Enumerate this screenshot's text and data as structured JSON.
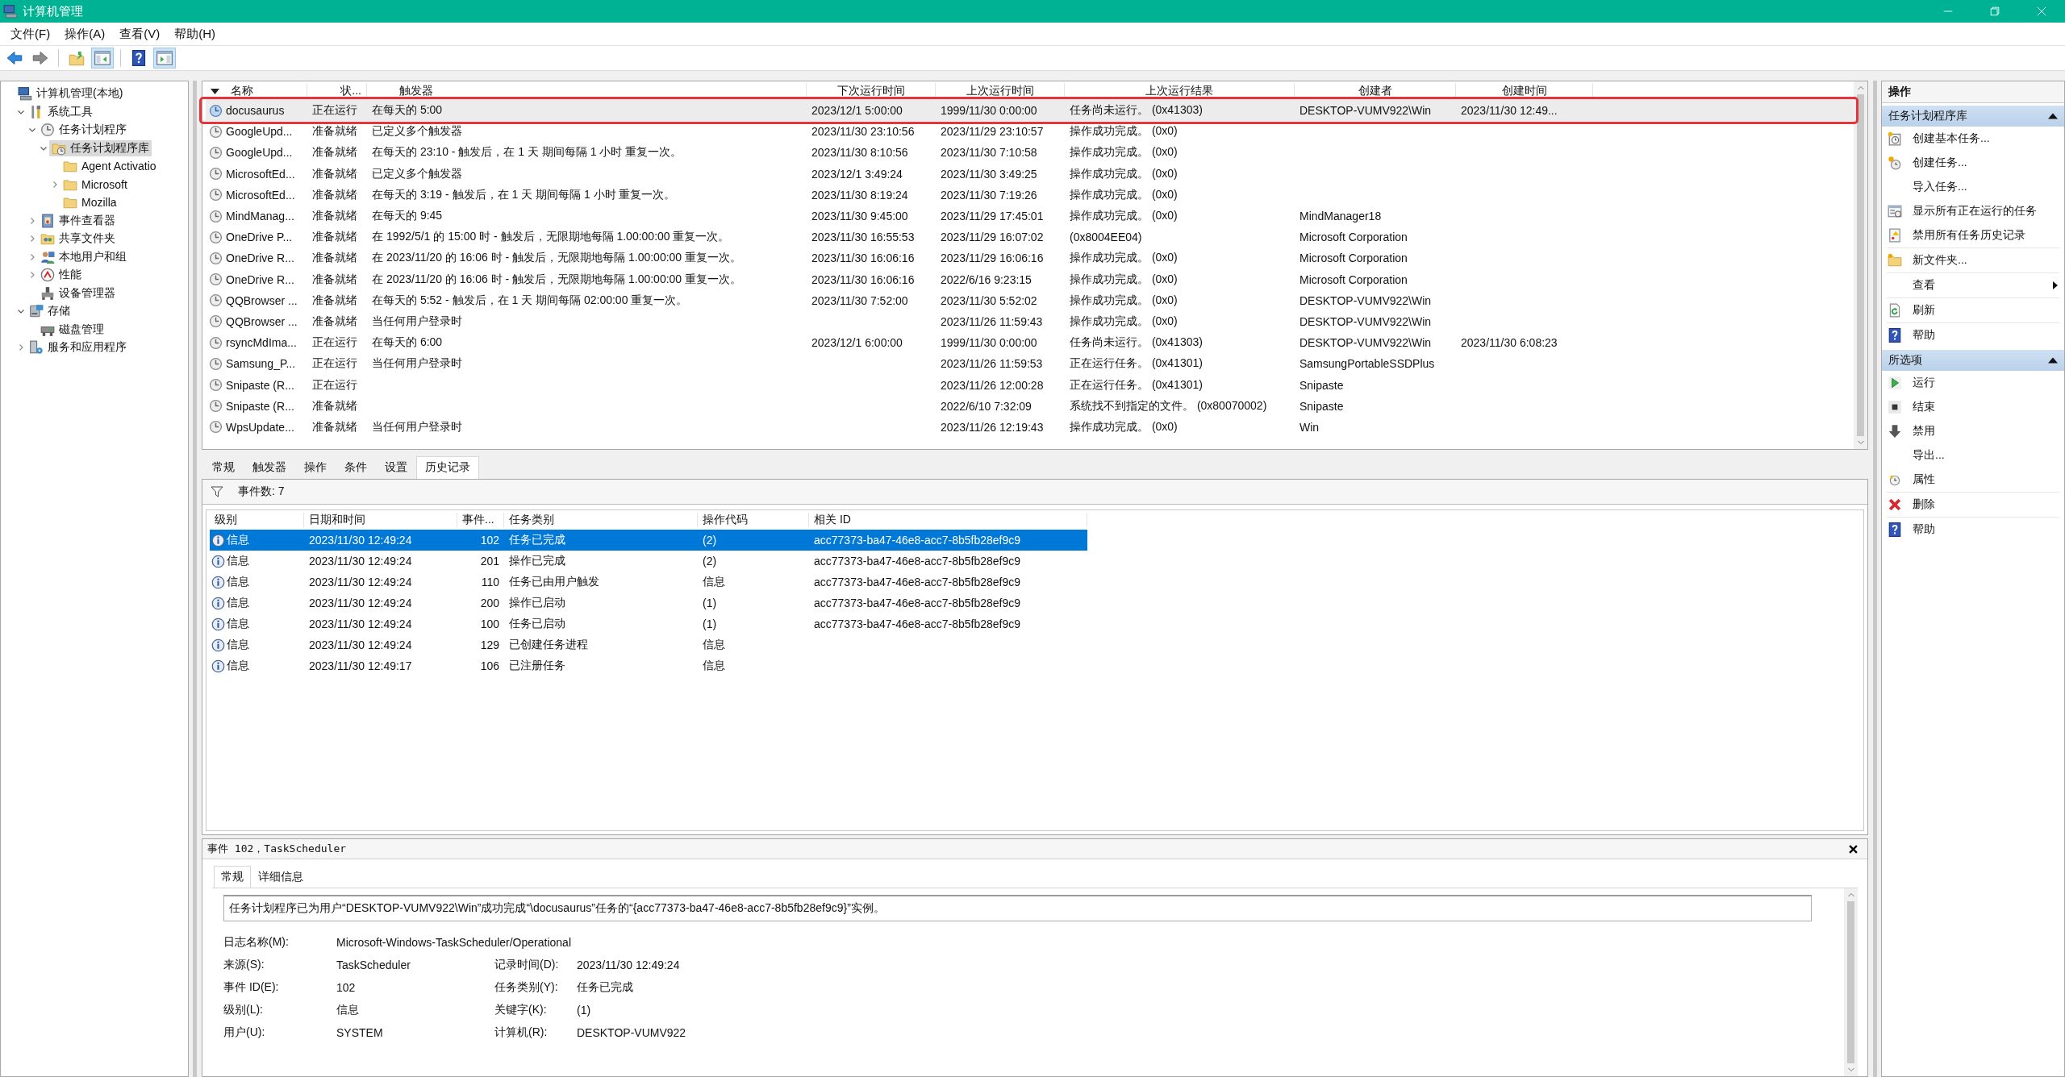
{
  "window": {
    "title": "计算机管理"
  },
  "menu": [
    "文件(F)",
    "操作(A)",
    "查看(V)",
    "帮助(H)"
  ],
  "toolbar": [
    {
      "pressed": false
    },
    {
      "pressed": false
    },
    {
      "pressed": false
    },
    {
      "pressed": true
    },
    {
      "pressed": false
    },
    {
      "pressed": true
    }
  ],
  "tree": [
    {
      "label": "计算机管理(本地)",
      "selected": false,
      "children": [
        {
          "label": "系统工具",
          "selected": false,
          "expanded": true,
          "children": [
            {
              "label": "任务计划程序",
              "selected": false,
              "expanded": true,
              "children": [
                {
                  "label": "任务计划程序库",
                  "selected": true,
                  "expanded": true,
                  "children": [
                    {
                      "label": "Agent Activatio",
                      "selected": false
                    },
                    {
                      "label": "Microsoft",
                      "selected": false,
                      "expanded": false
                    },
                    {
                      "label": "Mozilla",
                      "selected": false
                    }
                  ]
                }
              ]
            },
            {
              "label": "事件查看器",
              "selected": false,
              "expanded": false
            },
            {
              "label": "共享文件夹",
              "selected": false,
              "expanded": false
            },
            {
              "label": "本地用户和组",
              "selected": false,
              "expanded": false
            },
            {
              "label": "性能",
              "selected": false,
              "expanded": false
            },
            {
              "label": "设备管理器",
              "selected": false
            }
          ]
        },
        {
          "label": "存储",
          "selected": false,
          "expanded": true,
          "children": [
            {
              "label": "磁盘管理",
              "selected": false
            }
          ]
        },
        {
          "label": "服务和应用程序",
          "selected": false,
          "expanded": false
        }
      ]
    }
  ],
  "tasks": {
    "columns": [
      "名称",
      "状...",
      "触发器",
      "下次运行时间",
      "上次运行时间",
      "上次运行结果",
      "创建者",
      "创建时间"
    ],
    "rows": [
      {
        "name": "docusaurus",
        "status": "正在运行",
        "trigger": "在每天的 5:00",
        "next_run": "2023/12/1 5:00:00",
        "last_run": "1999/11/30 0:00:00",
        "last_result": "任务尚未运行。 (0x41303)",
        "author": "DESKTOP-VUMV922\\Win",
        "created": "2023/11/30 12:49...",
        "selected": true,
        "annotated": true
      },
      {
        "name": "GoogleUpd...",
        "status": "准备就绪",
        "trigger": "已定义多个触发器",
        "next_run": "2023/11/30 23:10:56",
        "last_run": "2023/11/29 23:10:57",
        "last_result": "操作成功完成。 (0x0)",
        "selected": false,
        "annotated": false
      },
      {
        "name": "GoogleUpd...",
        "status": "准备就绪",
        "trigger": "在每天的 23:10 - 触发后，在 1 天 期间每隔 1 小时 重复一次。",
        "next_run": "2023/11/30 8:10:56",
        "last_run": "2023/11/30 7:10:58",
        "last_result": "操作成功完成。 (0x0)",
        "selected": false,
        "annotated": false
      },
      {
        "name": "MicrosoftEd...",
        "status": "准备就绪",
        "trigger": "已定义多个触发器",
        "next_run": "2023/12/1 3:49:24",
        "last_run": "2023/11/30 3:49:25",
        "last_result": "操作成功完成。 (0x0)",
        "selected": false,
        "annotated": false
      },
      {
        "name": "MicrosoftEd...",
        "status": "准备就绪",
        "trigger": "在每天的 3:19 - 触发后，在 1 天 期间每隔 1 小时 重复一次。",
        "next_run": "2023/11/30 8:19:24",
        "last_run": "2023/11/30 7:19:26",
        "last_result": "操作成功完成。 (0x0)",
        "selected": false,
        "annotated": false
      },
      {
        "name": "MindManag...",
        "status": "准备就绪",
        "trigger": "在每天的 9:45",
        "next_run": "2023/11/30 9:45:00",
        "last_run": "2023/11/29 17:45:01",
        "last_result": "操作成功完成。 (0x0)",
        "author": "MindManager18",
        "selected": false,
        "annotated": false
      },
      {
        "name": "OneDrive P...",
        "status": "准备就绪",
        "trigger": "在 1992/5/1 的 15:00 时 - 触发后，无限期地每隔 1.00:00:00 重复一次。",
        "next_run": "2023/11/30 16:55:53",
        "last_run": "2023/11/29 16:07:02",
        "last_result": "(0x8004EE04)",
        "author": "Microsoft Corporation",
        "selected": false,
        "annotated": false
      },
      {
        "name": "OneDrive R...",
        "status": "准备就绪",
        "trigger": "在 2023/11/20 的 16:06 时 - 触发后，无限期地每隔 1.00:00:00 重复一次。",
        "next_run": "2023/11/30 16:06:16",
        "last_run": "2023/11/29 16:06:16",
        "last_result": "操作成功完成。 (0x0)",
        "author": "Microsoft Corporation",
        "selected": false,
        "annotated": false
      },
      {
        "name": "OneDrive R...",
        "status": "准备就绪",
        "trigger": "在 2023/11/20 的 16:06 时 - 触发后，无限期地每隔 1.00:00:00 重复一次。",
        "next_run": "2023/11/30 16:06:16",
        "last_run": "2022/6/16 9:23:15",
        "last_result": "操作成功完成。 (0x0)",
        "author": "Microsoft Corporation",
        "selected": false,
        "annotated": false
      },
      {
        "name": "QQBrowser ...",
        "status": "准备就绪",
        "trigger": "在每天的 5:52 - 触发后，在 1 天 期间每隔 02:00:00 重复一次。",
        "next_run": "2023/11/30 7:52:00",
        "last_run": "2023/11/30 5:52:02",
        "last_result": "操作成功完成。 (0x0)",
        "author": "DESKTOP-VUMV922\\Win",
        "selected": false,
        "annotated": false
      },
      {
        "name": "QQBrowser ...",
        "status": "准备就绪",
        "trigger": "当任何用户登录时",
        "last_run": "2023/11/26 11:59:43",
        "last_result": "操作成功完成。 (0x0)",
        "author": "DESKTOP-VUMV922\\Win",
        "selected": false,
        "annotated": false
      },
      {
        "name": "rsyncMdIma...",
        "status": "正在运行",
        "trigger": "在每天的 6:00",
        "next_run": "2023/12/1 6:00:00",
        "last_run": "1999/11/30 0:00:00",
        "last_result": "任务尚未运行。 (0x41303)",
        "author": "DESKTOP-VUMV922\\Win",
        "created": "2023/11/30 6:08:23",
        "selected": false,
        "annotated": false
      },
      {
        "name": "Samsung_P...",
        "status": "正在运行",
        "trigger": "当任何用户登录时",
        "last_run": "2023/11/26 11:59:53",
        "last_result": "正在运行任务。 (0x41301)",
        "author": "SamsungPortableSSDPlus",
        "selected": false,
        "annotated": false
      },
      {
        "name": "Snipaste (R...",
        "status": "正在运行",
        "last_run": "2023/11/26 12:00:28",
        "last_result": "正在运行任务。 (0x41301)",
        "author": "Snipaste",
        "selected": false,
        "annotated": false
      },
      {
        "name": "Snipaste (R...",
        "status": "准备就绪",
        "last_run": "2022/6/10 7:32:09",
        "last_result": "系统找不到指定的文件。 (0x80070002)",
        "author": "Snipaste",
        "selected": false,
        "annotated": false
      },
      {
        "name": "WpsUpdate...",
        "status": "准备就绪",
        "trigger": "当任何用户登录时",
        "last_run": "2023/11/26 12:19:43",
        "last_result": "操作成功完成。 (0x0)",
        "author": "Win",
        "selected": false,
        "annotated": false
      }
    ]
  },
  "detail_tabs": [
    {
      "label": "常规",
      "selected": false
    },
    {
      "label": "触发器",
      "selected": false
    },
    {
      "label": "操作",
      "selected": false
    },
    {
      "label": "条件",
      "selected": false
    },
    {
      "label": "设置",
      "selected": false
    },
    {
      "label": "历史记录",
      "selected": true
    }
  ],
  "history": {
    "count": "事件数: 7",
    "columns": [
      "级别",
      "日期和时间",
      "事件...",
      "任务类别",
      "操作代码",
      "相关 ID"
    ],
    "rows": [
      {
        "level": "信息",
        "datetime": "2023/11/30 12:49:24",
        "event_id": "102",
        "category": "任务已完成",
        "opcode": "(2)",
        "related_id": "acc77373-ba47-46e8-acc7-8b5fb28ef9c9",
        "selected": true
      },
      {
        "level": "信息",
        "datetime": "2023/11/30 12:49:24",
        "event_id": "201",
        "category": "操作已完成",
        "opcode": "(2)",
        "related_id": "acc77373-ba47-46e8-acc7-8b5fb28ef9c9",
        "selected": false
      },
      {
        "level": "信息",
        "datetime": "2023/11/30 12:49:24",
        "event_id": "110",
        "category": "任务已由用户触发",
        "opcode": "信息",
        "related_id": "acc77373-ba47-46e8-acc7-8b5fb28ef9c9",
        "selected": false
      },
      {
        "level": "信息",
        "datetime": "2023/11/30 12:49:24",
        "event_id": "200",
        "category": "操作已启动",
        "opcode": "(1)",
        "related_id": "acc77373-ba47-46e8-acc7-8b5fb28ef9c9",
        "selected": false
      },
      {
        "level": "信息",
        "datetime": "2023/11/30 12:49:24",
        "event_id": "100",
        "category": "任务已启动",
        "opcode": "(1)",
        "related_id": "acc77373-ba47-46e8-acc7-8b5fb28ef9c9",
        "selected": false
      },
      {
        "level": "信息",
        "datetime": "2023/11/30 12:49:24",
        "event_id": "129",
        "category": "已创建任务进程",
        "opcode": "信息",
        "selected": false
      },
      {
        "level": "信息",
        "datetime": "2023/11/30 12:49:17",
        "event_id": "106",
        "category": "已注册任务",
        "opcode": "信息",
        "selected": false
      }
    ]
  },
  "event": {
    "title": "事件 102，TaskScheduler",
    "tabs": [
      {
        "label": "常规",
        "selected": true
      },
      {
        "label": "详细信息",
        "selected": false
      }
    ],
    "message": "任务计划程序已为用户“DESKTOP-VUMV922\\Win”成功完成“\\docusaurus”任务的“{acc77373-ba47-46e8-acc7-8b5fb28ef9c9}”实例。",
    "fields": [
      [
        {
          "label": "日志名称(M):",
          "value": "Microsoft-Windows-TaskScheduler/Operational"
        }
      ],
      [
        {
          "label": "来源(S):",
          "value": "TaskScheduler"
        },
        {
          "label": "记录时间(D):",
          "value": "2023/11/30 12:49:24"
        }
      ],
      [
        {
          "label": "事件 ID(E):",
          "value": "102"
        },
        {
          "label": "任务类别(Y):",
          "value": "任务已完成"
        }
      ],
      [
        {
          "label": "级别(L):",
          "value": "信息"
        },
        {
          "label": "关键字(K):",
          "value": "(1)"
        }
      ],
      [
        {
          "label": "用户(U):",
          "value": "SYSTEM"
        },
        {
          "label": "计算机(R):",
          "value": "DESKTOP-VUMV922"
        }
      ]
    ]
  },
  "actions": {
    "title": "操作",
    "sections": [
      {
        "title": "任务计划程序库",
        "expanded": true,
        "items": [
          {
            "label": "创建基本任务...",
            "divider": false
          },
          {
            "label": "创建任务...",
            "divider": false
          },
          {
            "label": "导入任务...",
            "divider": false
          },
          {
            "label": "显示所有正在运行的任务",
            "divider": false
          },
          {
            "label": "禁用所有任务历史记录",
            "divider": true
          },
          {
            "label": "新文件夹...",
            "divider": true
          },
          {
            "label": "查看",
            "divider": true,
            "submenu": true
          },
          {
            "label": "刷新",
            "divider": true
          },
          {
            "label": "帮助",
            "divider": false
          }
        ]
      },
      {
        "title": "所选项",
        "expanded": true,
        "items": [
          {
            "label": "运行",
            "divider": false
          },
          {
            "label": "结束",
            "divider": false
          },
          {
            "label": "禁用",
            "divider": false
          },
          {
            "label": "导出...",
            "divider": false
          },
          {
            "label": "属性",
            "divider": true
          },
          {
            "label": "删除",
            "divider": true
          },
          {
            "label": "帮助",
            "divider": false
          }
        ]
      }
    ]
  }
}
